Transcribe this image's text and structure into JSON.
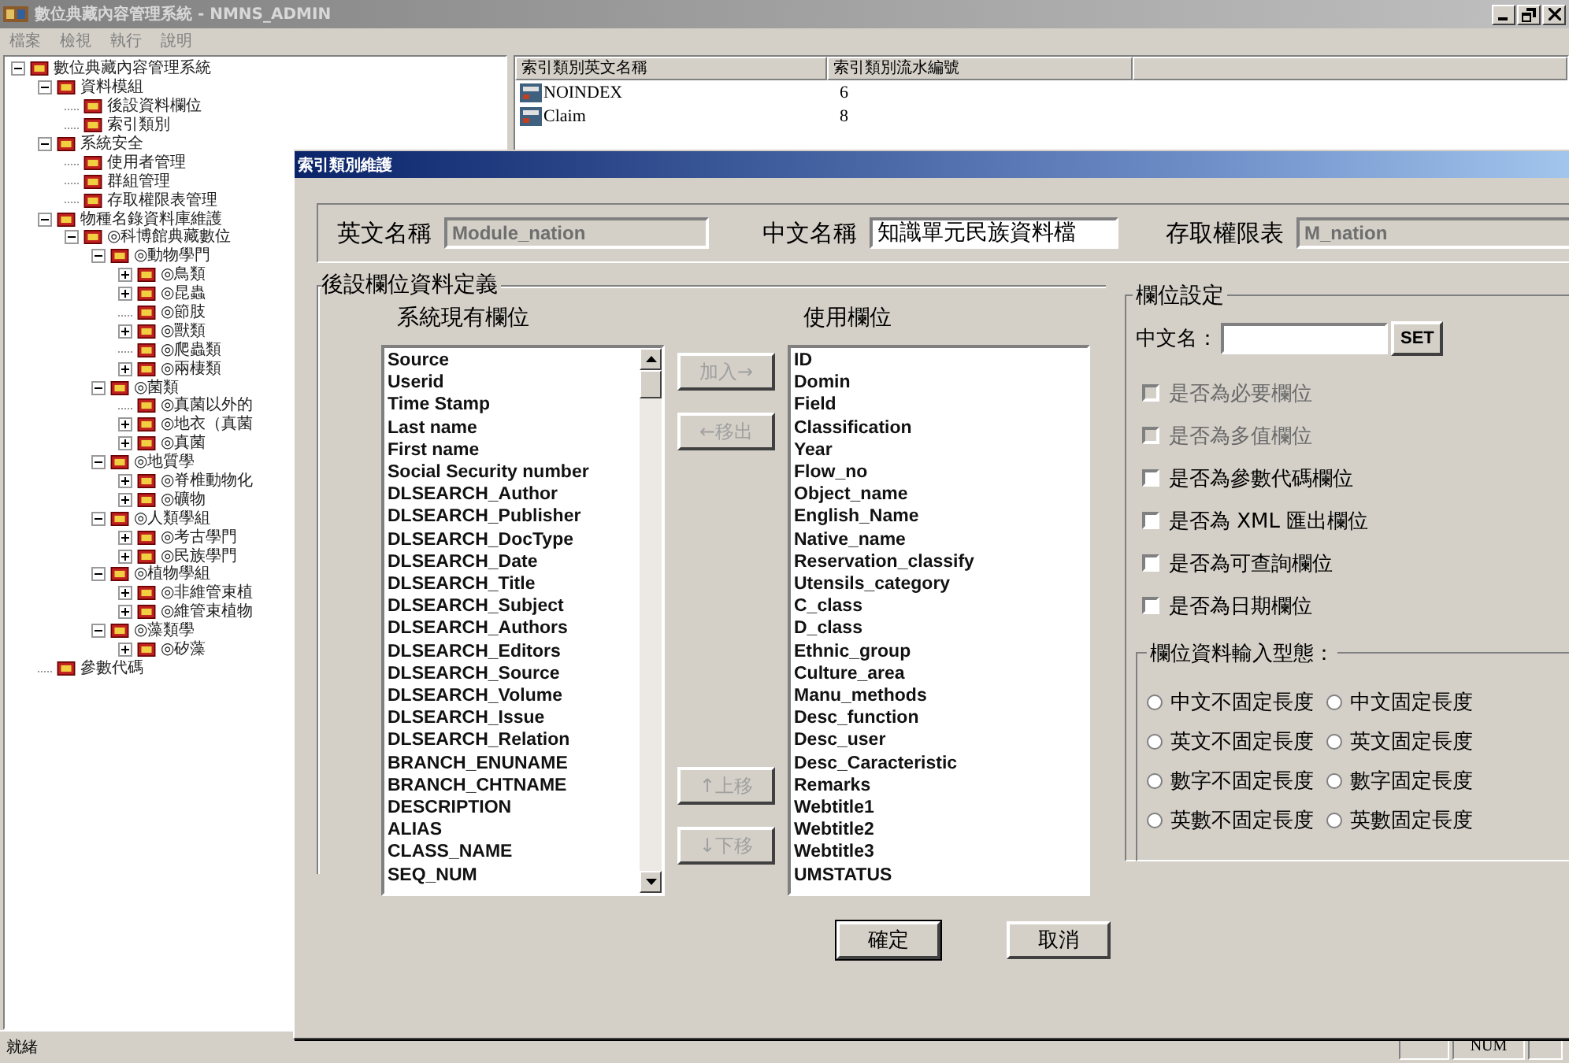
{
  "window": {
    "title": "數位典藏內容管理系統 - NMNS_ADMIN"
  },
  "menu": [
    "檔案",
    "檢視",
    "執行",
    "說明"
  ],
  "tree": [
    {
      "label": "數位典藏內容管理系統",
      "expanded": true,
      "children": [
        {
          "label": "資料模組",
          "expanded": true,
          "children": [
            {
              "label": "後設資料欄位"
            },
            {
              "label": "索引類別"
            }
          ]
        },
        {
          "label": "系統安全",
          "expanded": true,
          "children": [
            {
              "label": "使用者管理"
            },
            {
              "label": "群組管理"
            },
            {
              "label": "存取權限表管理"
            }
          ]
        },
        {
          "label": "物種名錄資料庫維護",
          "expanded": true,
          "children": [
            {
              "label": "◎科博館典藏數位",
              "expanded": true,
              "children": [
                {
                  "label": "◎動物學門",
                  "expanded": true,
                  "children": [
                    {
                      "label": "◎鳥類",
                      "expanded": false
                    },
                    {
                      "label": "◎昆蟲",
                      "expanded": false
                    },
                    {
                      "label": "◎節肢"
                    },
                    {
                      "label": "◎獸類",
                      "expanded": false
                    },
                    {
                      "label": "◎爬蟲類"
                    },
                    {
                      "label": "◎兩棲類",
                      "expanded": false
                    }
                  ]
                },
                {
                  "label": "◎菌類",
                  "expanded": true,
                  "children": [
                    {
                      "label": "◎真菌以外的"
                    },
                    {
                      "label": "◎地衣（真菌",
                      "expanded": false
                    },
                    {
                      "label": "◎真菌",
                      "expanded": false
                    }
                  ]
                },
                {
                  "label": "◎地質學",
                  "expanded": true,
                  "children": [
                    {
                      "label": "◎脊椎動物化",
                      "expanded": false
                    },
                    {
                      "label": "◎礦物",
                      "expanded": false
                    }
                  ]
                },
                {
                  "label": "◎人類學組",
                  "expanded": true,
                  "children": [
                    {
                      "label": "◎考古學門",
                      "expanded": false
                    },
                    {
                      "label": "◎民族學門",
                      "expanded": false
                    }
                  ]
                },
                {
                  "label": "◎植物學組",
                  "expanded": true,
                  "children": [
                    {
                      "label": "◎非維管束植",
                      "expanded": false
                    },
                    {
                      "label": "◎維管束植物",
                      "expanded": false
                    }
                  ]
                },
                {
                  "label": "◎藻類學",
                  "expanded": true,
                  "children": [
                    {
                      "label": "◎矽藻",
                      "expanded": false
                    }
                  ]
                }
              ]
            }
          ]
        },
        {
          "label": "參數代碼"
        }
      ]
    }
  ],
  "table": {
    "columns": [
      "索引類別英文名稱",
      "索引類別流水編號"
    ],
    "rows": [
      [
        "NOINDEX",
        "6"
      ],
      [
        "Claim",
        "8"
      ]
    ]
  },
  "dialog": {
    "title": "索引類別維護",
    "english_name": {
      "label": "英文名稱",
      "value": "Module_nation",
      "disabled": true
    },
    "chinese_name": {
      "label": "中文名稱",
      "value": "知識單元民族資料檔",
      "disabled": false
    },
    "access_table": {
      "label": "存取權限表",
      "value": "M_nation",
      "disabled": true
    },
    "group_title": "後設欄位資料定義",
    "available": {
      "title": "系統現有欄位",
      "items": [
        "Source",
        "Userid",
        "Time Stamp",
        "Last name",
        "First name",
        "Social Security number",
        "DLSEARCH_Author",
        "DLSEARCH_Publisher",
        "DLSEARCH_DocType",
        "DLSEARCH_Date",
        "DLSEARCH_Title",
        "DLSEARCH_Subject",
        "DLSEARCH_Authors",
        "DLSEARCH_Editors",
        "DLSEARCH_Source",
        "DLSEARCH_Volume",
        "DLSEARCH_Issue",
        "DLSEARCH_Relation",
        "BRANCH_ENUNAME",
        "BRANCH_CHTNAME",
        "DESCRIPTION",
        "ALIAS",
        "CLASS_NAME",
        "SEQ_NUM"
      ]
    },
    "used": {
      "title": "使用欄位",
      "items": [
        "ID",
        "Domin",
        "Field",
        "Classification",
        "Year",
        "Flow_no",
        "Object_name",
        "English_Name",
        "Native_name",
        "Reservation_classify",
        "Utensils_category",
        "C_class",
        "D_class",
        "Ethnic_group",
        "Culture_area",
        "Manu_methods",
        "Desc_function",
        "Desc_user",
        "Desc_Caracteristic",
        "Remarks",
        "Webtitle1",
        "Webtitle2",
        "Webtitle3",
        "UMSTATUS"
      ]
    },
    "move_buttons": [
      {
        "label": "加入→",
        "disabled": true
      },
      {
        "label": "←移出",
        "disabled": true
      }
    ],
    "order_buttons": [
      {
        "label": "↑上移",
        "disabled": true
      },
      {
        "label": "↓下移",
        "disabled": true
      }
    ],
    "settings": {
      "title": "欄位設定",
      "name_label": "中文名：",
      "set_button": "SET",
      "checkboxes": [
        {
          "label": "是否為必要欄位",
          "checked": false,
          "disabled": true
        },
        {
          "label": "是否為多值欄位",
          "checked": false,
          "disabled": true
        },
        {
          "label": "是否為參數代碼欄位",
          "checked": false,
          "disabled": false
        },
        {
          "label": "是否為 XML 匯出欄位",
          "checked": false,
          "disabled": false
        },
        {
          "label": "是否為可查詢欄位",
          "checked": false,
          "disabled": false
        },
        {
          "label": "是否為日期欄位",
          "checked": false,
          "disabled": false
        }
      ],
      "input_type": {
        "title": "欄位資料輸入型態：",
        "options": [
          {
            "label": "中文不固定長度",
            "selected": false
          },
          {
            "label": "中文固定長度",
            "selected": false
          },
          {
            "label": "英文不固定長度",
            "selected": false
          },
          {
            "label": "英文固定長度",
            "selected": false
          },
          {
            "label": "數字不固定長度",
            "selected": false
          },
          {
            "label": "數字固定長度",
            "selected": false
          },
          {
            "label": "英數不固定長度",
            "selected": false
          },
          {
            "label": "英數固定長度",
            "selected": false
          }
        ]
      }
    },
    "buttons": [
      "確定",
      "取消"
    ]
  },
  "status_bar": {
    "text": "就緒",
    "indicator": "NUM"
  }
}
